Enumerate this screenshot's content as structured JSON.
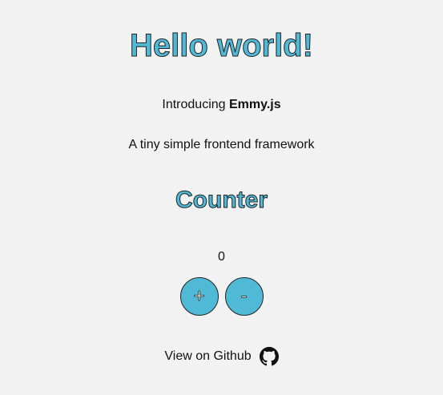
{
  "header": {
    "title": "Hello world!"
  },
  "intro": {
    "prefix": "Introducing ",
    "name": "Emmy.js"
  },
  "tagline": "A tiny simple frontend framework",
  "counter": {
    "title": "Counter",
    "value": "0",
    "increment_label": "+",
    "decrement_label": "-"
  },
  "footer": {
    "github_label": "View on Github",
    "icon": "github-icon"
  },
  "colors": {
    "accent": "#4fb9d6",
    "background": "#f2f2f2",
    "stroke": "#222222"
  }
}
